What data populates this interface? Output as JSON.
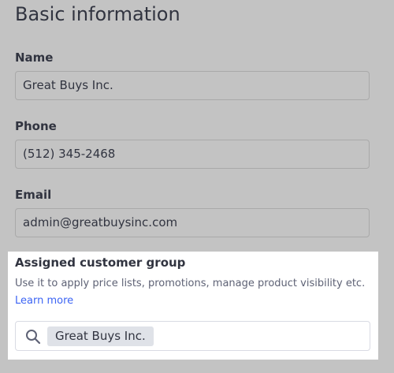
{
  "section": {
    "title": "Basic information"
  },
  "fields": {
    "name": {
      "label": "Name",
      "value": "Great Buys Inc."
    },
    "phone": {
      "label": "Phone",
      "value": "(512) 345-2468"
    },
    "email": {
      "label": "Email",
      "value": "admin@greatbuysinc.com"
    }
  },
  "customer_group": {
    "title": "Assigned customer group",
    "description": "Use it to apply price lists, promotions, manage product visibility etc.",
    "learn_more": "Learn more",
    "search_icon": "search-icon",
    "selected_tag": "Great Buys Inc."
  },
  "colors": {
    "link": "#3c64f4",
    "overlay": "#c3c3c3",
    "panel": "#ffffff"
  }
}
